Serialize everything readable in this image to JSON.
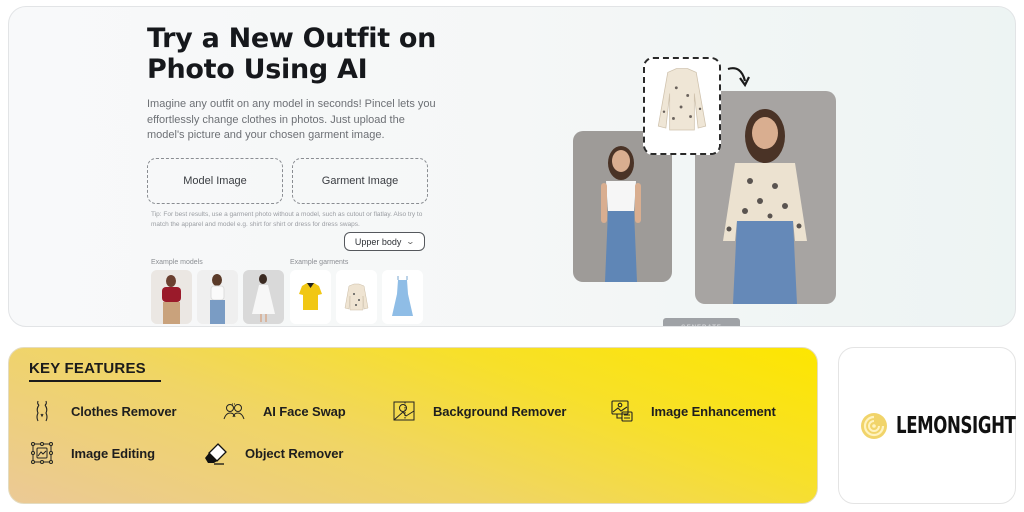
{
  "hero": {
    "title_line1": "Try a New Outfit on",
    "title_line2": "Photo Using AI",
    "description": "Imagine any outfit on any model in seconds! Pincel lets you effortlessly change clothes in photos. Just upload the model's picture and your chosen garment image.",
    "model_upload_label": "Model Image",
    "garment_upload_label": "Garment Image",
    "tip": "Tip: For best results, use a garment photo without a model, such as cutout or flatlay. Also try to match the apparel and model e.g. shirt for shirt or dress for dress swaps.",
    "body_select": {
      "selected": "Upper body",
      "icon": "chevron-down-icon"
    },
    "example_models_label": "Example models",
    "example_garments_label": "Example garments",
    "example_models": [
      {
        "name": "red-top-model"
      },
      {
        "name": "white-tank-model"
      },
      {
        "name": "white-dress-model"
      }
    ],
    "example_garments": [
      {
        "name": "yellow-polo"
      },
      {
        "name": "floral-blouse"
      },
      {
        "name": "blue-dress"
      }
    ],
    "generate_label": "GENERATE"
  },
  "features": {
    "title": "KEY FEATURES",
    "items": [
      {
        "label": "Clothes Remover",
        "icon": "body-silhouette-icon"
      },
      {
        "label": "AI Face Swap",
        "icon": "face-swap-icon"
      },
      {
        "label": "Background Remover",
        "icon": "background-remover-icon"
      },
      {
        "label": "Image Enhancement",
        "icon": "image-enhancement-icon"
      },
      {
        "label": "Image Editing",
        "icon": "image-editing-icon"
      },
      {
        "label": "Object Remover",
        "icon": "eraser-icon"
      }
    ]
  },
  "brand": {
    "name": "LEMONSIGHT",
    "accent": "#f0d060"
  }
}
